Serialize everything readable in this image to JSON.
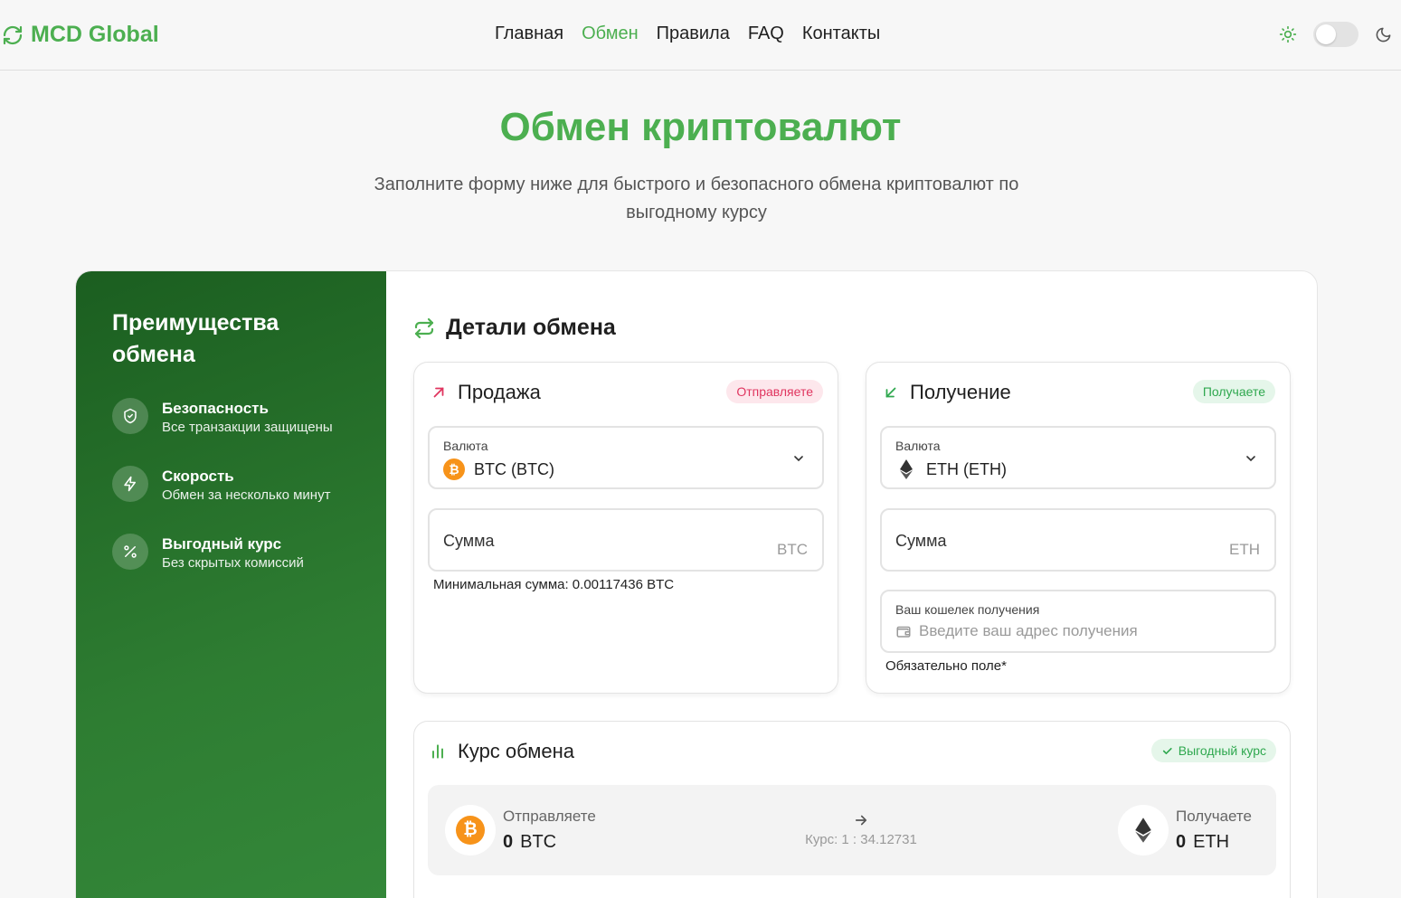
{
  "header": {
    "logo": "MCD Global",
    "nav": [
      "Главная",
      "Обмен",
      "Правила",
      "FAQ",
      "Контакты"
    ],
    "active_nav": "Обмен"
  },
  "hero": {
    "title": "Обмен криптовалют",
    "subtitle": "Заполните форму ниже для быстрого и безопасного обмена криптовалют по выгодному курсу"
  },
  "sidebar": {
    "title": "Преимущества обмена",
    "items": [
      {
        "title": "Безопасность",
        "subtitle": "Все транзакции защищены",
        "icon": "shield-icon"
      },
      {
        "title": "Скорость",
        "subtitle": "Обмен за несколько минут",
        "icon": "lightning-icon"
      },
      {
        "title": "Выгодный курс",
        "subtitle": "Без скрытых комиссий",
        "icon": "percent-icon"
      }
    ]
  },
  "details": {
    "title": "Детали обмена"
  },
  "sell": {
    "title": "Продажа",
    "badge": "Отправляете",
    "currency_label": "Валюта",
    "currency_value": "BTC (BTC)",
    "amount_placeholder": "Сумма",
    "amount_unit": "BTC",
    "min_note": "Минимальная сумма: 0.00117436 BTC"
  },
  "receive": {
    "title": "Получение",
    "badge": "Получаете",
    "currency_label": "Валюта",
    "currency_value": "ETH (ETH)",
    "amount_placeholder": "Сумма",
    "amount_unit": "ETH",
    "wallet_label": "Ваш кошелек получения",
    "wallet_placeholder": "Введите ваш адрес получения",
    "required_note": "Обязательно поле*"
  },
  "rate": {
    "title": "Курс обмена",
    "badge": "Выгодный курс",
    "send_label": "Отправляете",
    "send_amount": "0",
    "send_unit": "BTC",
    "rate_text": "Курс: 1 : 34.12731",
    "recv_label": "Получаете",
    "recv_amount": "0",
    "recv_unit": "ETH"
  },
  "colors": {
    "accent": "#4caf50",
    "sidebar_dark": "#1b5e20",
    "send_badge": "#e0355f",
    "recv_badge": "#2fa84f",
    "btc": "#f7931a"
  }
}
